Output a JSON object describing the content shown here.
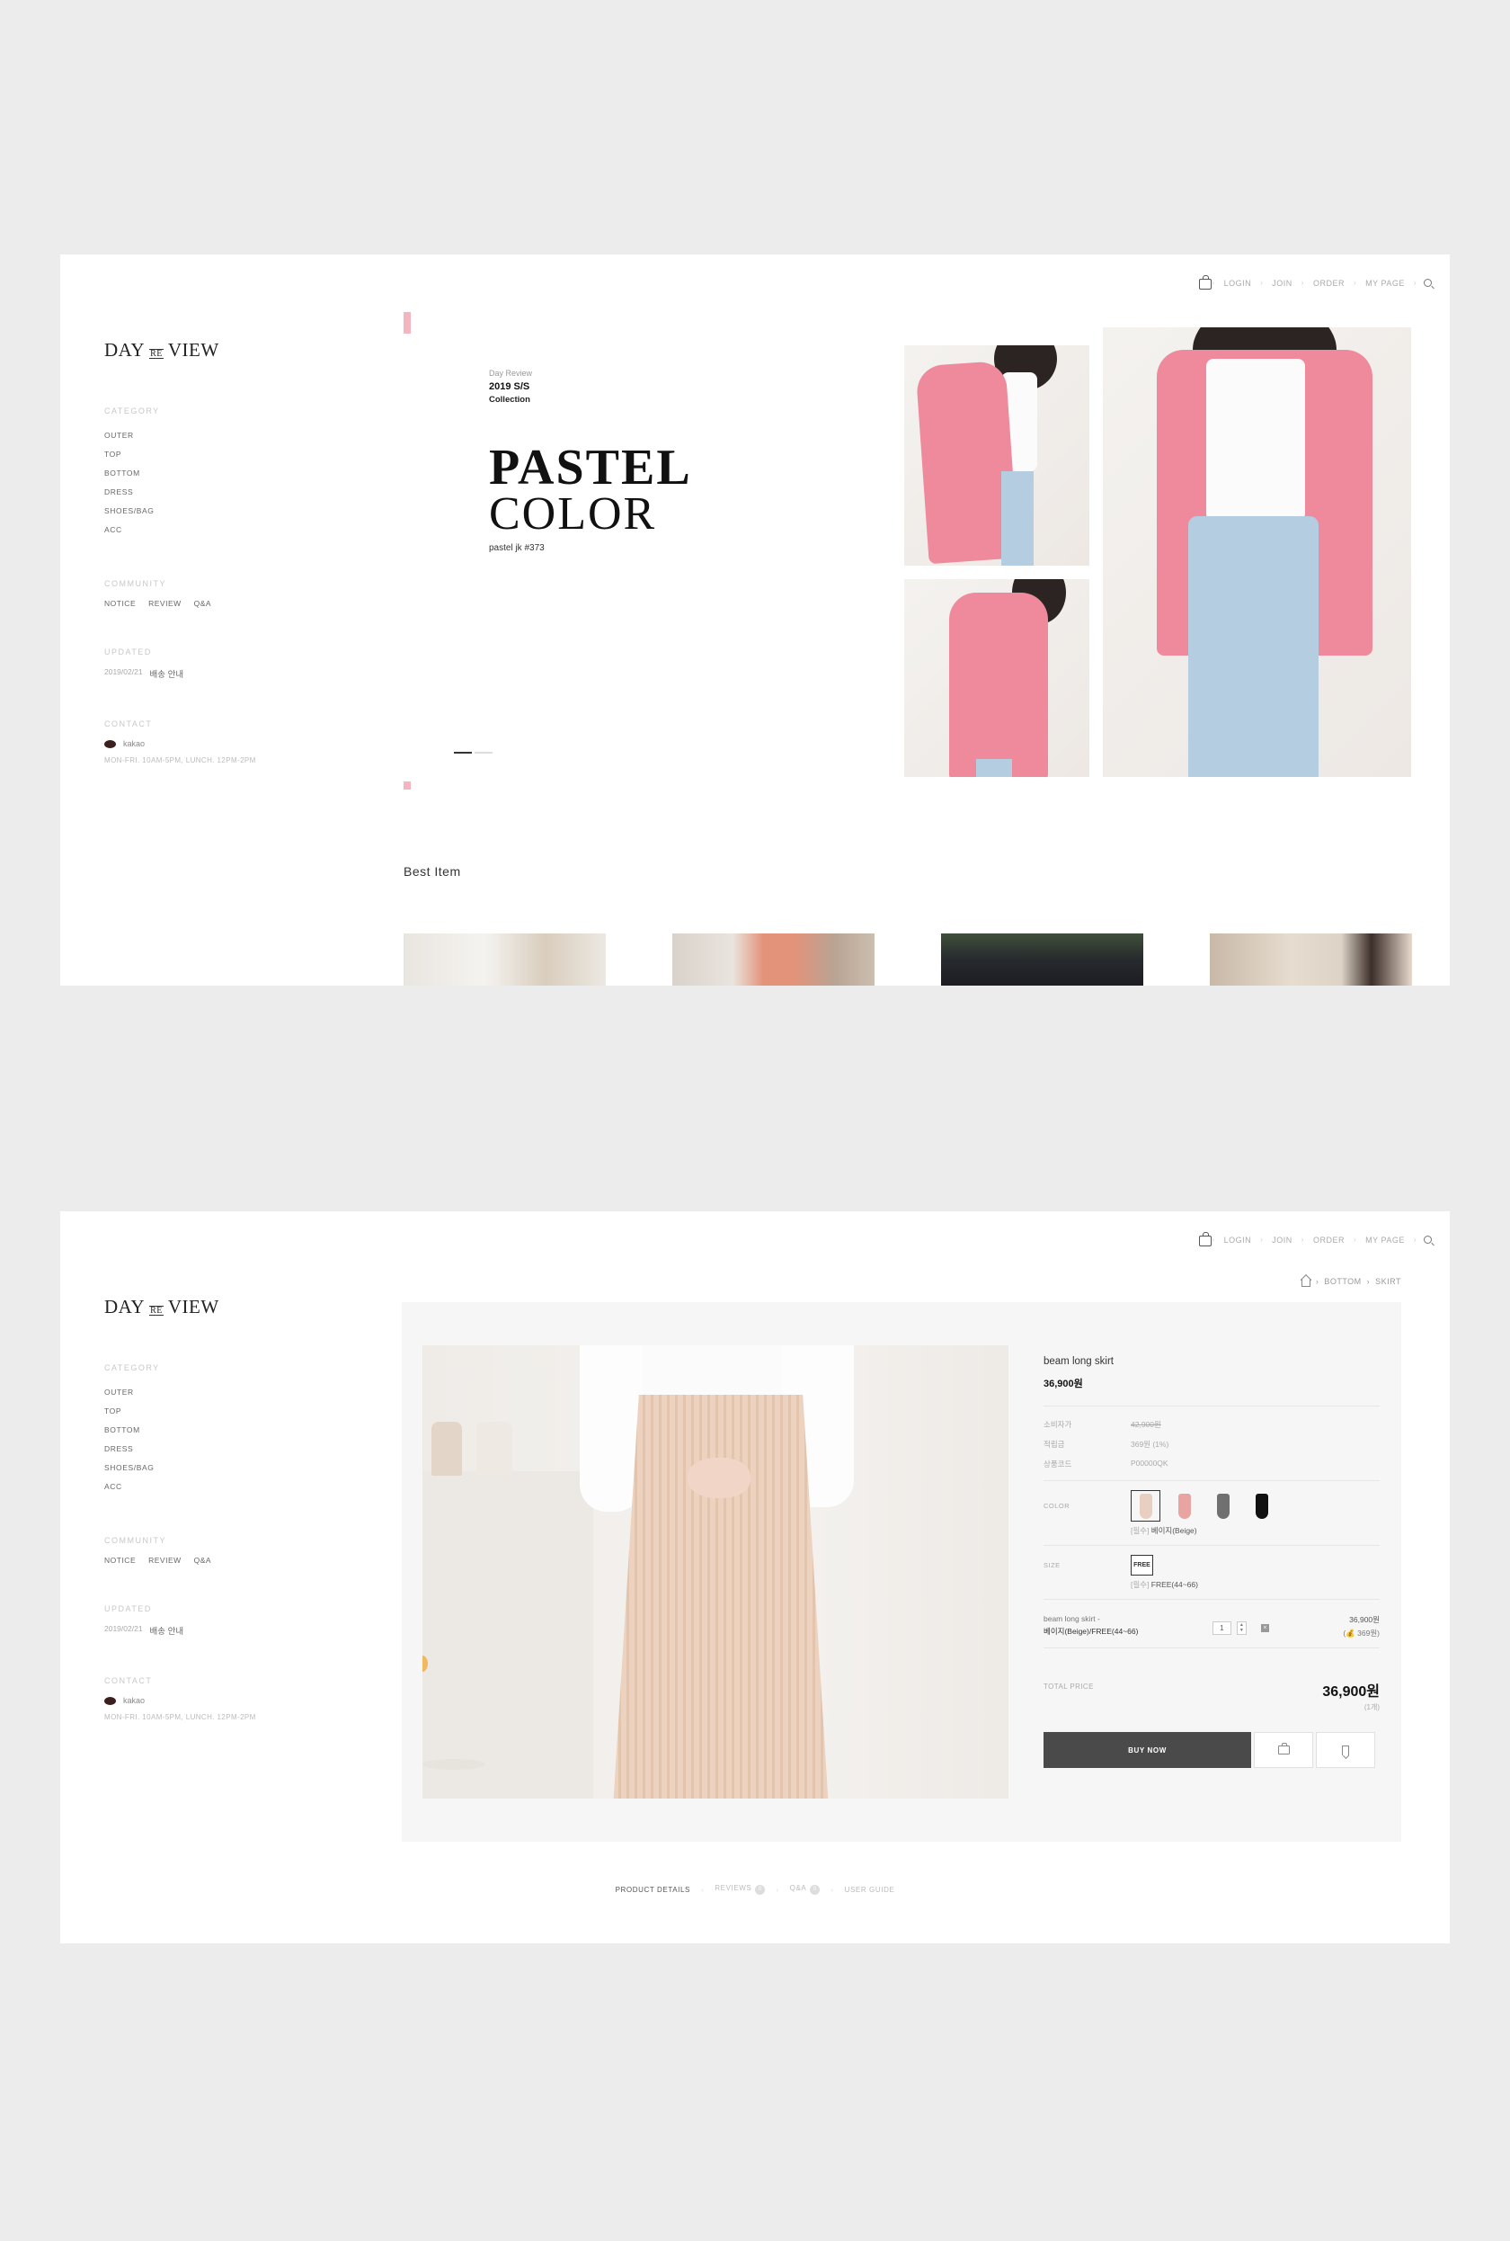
{
  "site": {
    "logo_left": "DAY",
    "logo_mid": "RE",
    "logo_right": "VIEW"
  },
  "topnav": {
    "items": [
      "LOGIN",
      "JOIN",
      "ORDER",
      "MY PAGE"
    ],
    "cart_icon": "shopping-bag-icon",
    "search_icon": "search-icon"
  },
  "sidebar": {
    "category_heading": "CATEGORY",
    "categories": [
      "OUTER",
      "TOP",
      "BOTTOM",
      "DRESS",
      "SHOES/BAG",
      "ACC"
    ],
    "community_heading": "COMMUNITY",
    "community": [
      "NOTICE",
      "REVIEW",
      "Q&A"
    ],
    "updated_heading": "UPDATED",
    "updated_date": "2019/02/21",
    "updated_title": "배송 안내",
    "contact_heading": "CONTACT",
    "contact_kakao": "kakao",
    "contact_hours": "MON-FRI. 10AM-5PM, LUNCH. 12PM-2PM"
  },
  "hero": {
    "brand": "Day Review",
    "season": "2019 S/S",
    "collection": "Collection",
    "headline_1": "PASTEL",
    "headline_2": "COLOR",
    "caption": "pastel jk #373",
    "slides": 2,
    "active_slide": 1,
    "accent_color": "#f3b6c0"
  },
  "best": {
    "title": "Best Item",
    "thumbs": 4
  },
  "breadcrumb": {
    "home_icon": "home-icon",
    "items": [
      "BOTTOM",
      "SKIRT"
    ]
  },
  "product": {
    "name": "beam long skirt",
    "price": "36,900원",
    "rows": [
      {
        "label": "소비자가",
        "value": "42,900원",
        "strike": true
      },
      {
        "label": "적립금",
        "value": "369원 (1%)",
        "strike": false
      },
      {
        "label": "상품코드",
        "value": "P00000QK",
        "strike": false
      }
    ],
    "color_label": "COLOR",
    "colors": [
      {
        "name": "beige",
        "hex": "#e9cfc0",
        "selected": true
      },
      {
        "name": "pink",
        "hex": "#e7a4a0",
        "selected": false
      },
      {
        "name": "gray",
        "hex": "#707070",
        "selected": false
      },
      {
        "name": "black",
        "hex": "#111111",
        "selected": false
      }
    ],
    "color_required": "[필수]",
    "color_selected": "베이지(Beige)",
    "size_label": "SIZE",
    "size_value": "FREE",
    "size_required": "[필수]",
    "size_selected": "FREE(44~66)",
    "selected_item_name": "beam long skirt -",
    "selected_item_option": "베이지(Beige)/FREE(44~66)",
    "selected_qty": "1",
    "selected_price": "36,900원",
    "selected_points": "(💰 369원)",
    "total_label": "TOTAL PRICE",
    "total_amount": "36,900원",
    "total_count": "(1개)",
    "buy_label": "BUY NOW",
    "cart_icon": "shopping-bag-icon",
    "wish_icon": "bookmark-icon"
  },
  "tabs": {
    "items": [
      {
        "label": "PRODUCT DETAILS",
        "active": true,
        "badge": ""
      },
      {
        "label": "REVIEWS",
        "active": false,
        "badge": "0"
      },
      {
        "label": "Q&A",
        "active": false,
        "badge": "0"
      },
      {
        "label": "USER GUIDE",
        "active": false,
        "badge": ""
      }
    ]
  }
}
